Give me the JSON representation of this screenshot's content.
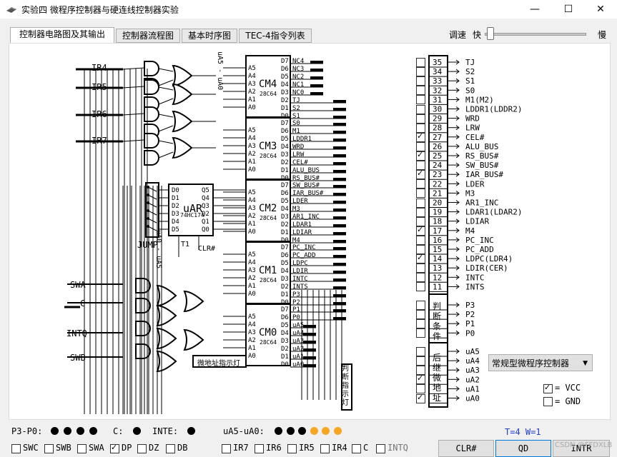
{
  "window": {
    "title": "实验四 微程序控制器与硬连线控制器实验",
    "minimize": "—",
    "maximize": "☐",
    "close": "✕"
  },
  "tabs": [
    "控制器电路图及其输出",
    "控制器流程图",
    "基本时序图",
    "TEC-4指令列表"
  ],
  "speed": {
    "label_left": "调速",
    "fast": "快",
    "slow": "慢",
    "value": 0.02
  },
  "diagram": {
    "inputs": [
      "IR4",
      "IR5",
      "IR6",
      "IR7"
    ],
    "switch_inputs": [
      "SWA",
      "C",
      "INTQ",
      "SWB"
    ],
    "uar": {
      "name": "uAR",
      "chip": "74HC174",
      "d": [
        "D0",
        "D1",
        "D2",
        "D3",
        "D4",
        "D5"
      ],
      "q": [
        "Q5",
        "Q4",
        "Q3",
        "Q2",
        "Q1",
        "Q0"
      ],
      "t1": "T1",
      "clr": "CLR#",
      "out_label": "uA0 - uA5"
    },
    "jump": "JUMP",
    "ua_label": "uA5 - uA0",
    "chips": [
      {
        "name": "CM4",
        "type": "28C64",
        "outputs": [
          "NC4",
          "NC3",
          "NC2",
          "NC1",
          "NC0",
          "TJ",
          "S2",
          "S1"
        ]
      },
      {
        "name": "CM3",
        "type": "28C64",
        "outputs": [
          "S0",
          "M1",
          "LDDR1",
          "WRD",
          "LRW",
          "CEL#",
          "ALU_BUS",
          "RS_BUS#"
        ]
      },
      {
        "name": "CM2",
        "type": "28C64",
        "outputs": [
          "SW_BUS#",
          "IAR_BUS#",
          "LDER",
          "M3",
          "AR1_INC",
          "LDAR1",
          "LDIAR",
          "M4"
        ]
      },
      {
        "name": "CM1",
        "type": "28C64",
        "outputs": [
          "PC_INC",
          "PC_ADD",
          "LDPC",
          "LDIR",
          "INTC",
          "INTS",
          "P3",
          "P2"
        ]
      },
      {
        "name": "CM0",
        "type": "28C64",
        "outputs": [
          "P1",
          "P0",
          "uA5",
          "uA4",
          "uA3",
          "uA2",
          "uA1",
          "uA0"
        ]
      }
    ],
    "addr_pins": [
      "A5",
      "A4",
      "A3",
      "A2",
      "A1",
      "A0"
    ],
    "data_pins": [
      "D7",
      "D6",
      "D5",
      "D4",
      "D3",
      "D2",
      "D1",
      "D0"
    ],
    "micro_addr_lamp": "微地址指示灯",
    "judge_lamp": "判断指示灯"
  },
  "signals": [
    {
      "num": "35",
      "name": "TJ",
      "checked": false
    },
    {
      "num": "34",
      "name": "S2",
      "checked": false
    },
    {
      "num": "33",
      "name": "S1",
      "checked": false
    },
    {
      "num": "32",
      "name": "S0",
      "checked": false
    },
    {
      "num": "31",
      "name": "M1(M2)",
      "checked": false
    },
    {
      "num": "30",
      "name": "LDDR1(LDDR2)",
      "checked": false
    },
    {
      "num": "29",
      "name": "WRD",
      "checked": false
    },
    {
      "num": "28",
      "name": "LRW",
      "checked": false
    },
    {
      "num": "27",
      "name": "CEL#",
      "checked": true
    },
    {
      "num": "26",
      "name": "ALU_BUS",
      "checked": false
    },
    {
      "num": "25",
      "name": "RS_BUS#",
      "checked": true
    },
    {
      "num": "24",
      "name": "SW_BUS#",
      "checked": false
    },
    {
      "num": "23",
      "name": "IAR_BUS#",
      "checked": true
    },
    {
      "num": "22",
      "name": "LDER",
      "checked": false
    },
    {
      "num": "21",
      "name": "M3",
      "checked": false
    },
    {
      "num": "20",
      "name": "AR1_INC",
      "checked": false
    },
    {
      "num": "19",
      "name": "LDAR1(LDAR2)",
      "checked": false
    },
    {
      "num": "18",
      "name": "LDIAR",
      "checked": false
    },
    {
      "num": "17",
      "name": "M4",
      "checked": true
    },
    {
      "num": "16",
      "name": "PC_INC",
      "checked": false
    },
    {
      "num": "15",
      "name": "PC_ADD",
      "checked": false
    },
    {
      "num": "14",
      "name": "LDPC(LDR4)",
      "checked": true
    },
    {
      "num": "13",
      "name": "LDIR(CER)",
      "checked": false
    },
    {
      "num": "12",
      "name": "INTC",
      "checked": false
    },
    {
      "num": "11",
      "name": "INTS",
      "checked": false
    }
  ],
  "judge": {
    "label": "判断条件",
    "items": [
      {
        "name": "P3",
        "checked": false
      },
      {
        "name": "P2",
        "checked": false
      },
      {
        "name": "P1",
        "checked": false
      },
      {
        "name": "P0",
        "checked": false
      }
    ]
  },
  "next_addr": {
    "label": "后继微地址",
    "items": [
      {
        "name": "uA5",
        "checked": false
      },
      {
        "name": "uA4",
        "checked": false
      },
      {
        "name": "uA3",
        "checked": false
      },
      {
        "name": "uA2",
        "checked": true
      },
      {
        "name": "uA1",
        "checked": false
      },
      {
        "name": "uA0",
        "checked": true
      }
    ]
  },
  "controller_select": "常规型微程序控制器",
  "power": [
    {
      "label": "= VCC",
      "checked": true
    },
    {
      "label": "= GND",
      "checked": false
    }
  ],
  "status": {
    "p_label": "P3-P0:",
    "c_label": "C:",
    "inte_label": "INTE:",
    "ua_label": "uA5-uA0:",
    "p_dots": [
      "#000000",
      "#000000",
      "#000000",
      "#000000"
    ],
    "c_dot": "#000000",
    "inte_dot": "#000000",
    "ua_dots": [
      "#000000",
      "#000000",
      "#000000",
      "#f5a623",
      "#f5a623",
      "#f5a623"
    ],
    "timing": "T=4 W=1"
  },
  "switches": [
    {
      "label": "SWC",
      "checked": false
    },
    {
      "label": "SWB",
      "checked": false
    },
    {
      "label": "SWA",
      "checked": false
    },
    {
      "label": "DP",
      "checked": true
    },
    {
      "label": "DZ",
      "checked": false
    },
    {
      "label": "DB",
      "checked": false
    },
    {
      "label": "IR7",
      "checked": false
    },
    {
      "label": "IR6",
      "checked": false
    },
    {
      "label": "IR5",
      "checked": false
    },
    {
      "label": "IR4",
      "checked": false
    },
    {
      "label": "C",
      "checked": false
    },
    {
      "label": "INTQ",
      "checked": false
    }
  ],
  "buttons": {
    "clr": "CLR#",
    "qd": "QD",
    "intr": "INTR"
  },
  "watermark": "CSDN @FFDXLB"
}
